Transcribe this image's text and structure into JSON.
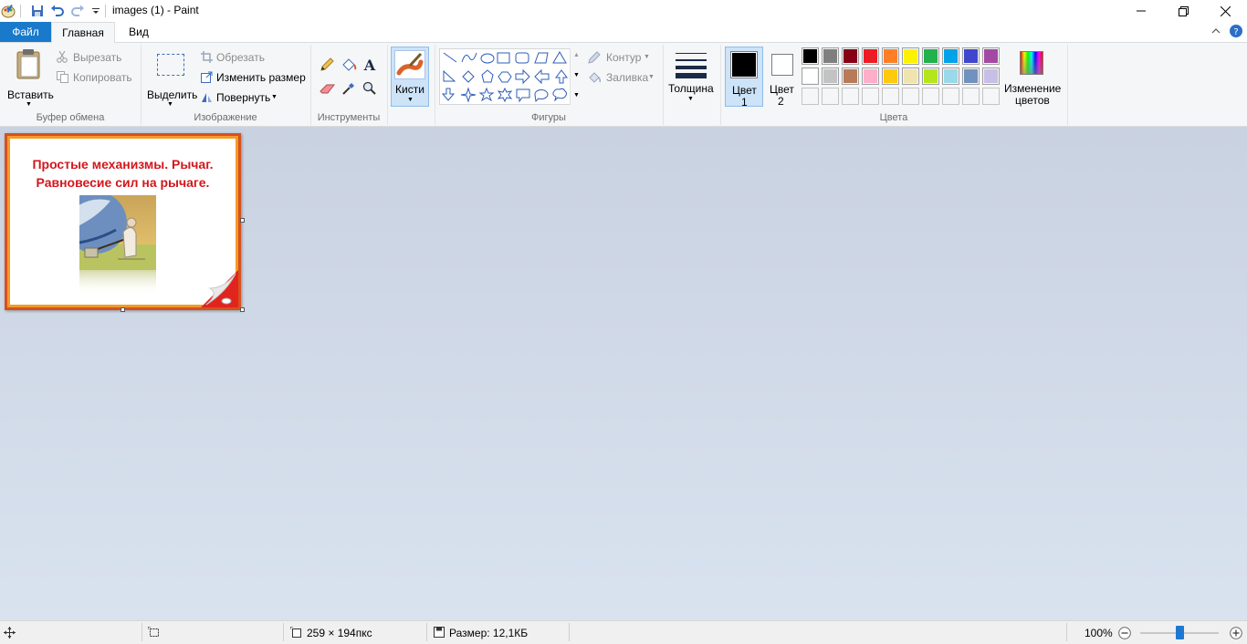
{
  "window": {
    "title": "images (1) - Paint"
  },
  "tabs": {
    "file": "Файл",
    "home": "Главная",
    "view": "Вид"
  },
  "clipboard": {
    "paste": "Вставить",
    "cut": "Вырезать",
    "copy": "Копировать",
    "label": "Буфер обмена"
  },
  "image": {
    "select": "Выделить",
    "crop": "Обрезать",
    "resize": "Изменить размер",
    "rotate": "Повернуть",
    "label": "Изображение"
  },
  "tools": {
    "label": "Инструменты"
  },
  "brushes": {
    "label": "Кисти"
  },
  "shapes": {
    "outline": "Контур",
    "fill": "Заливка",
    "label": "Фигуры"
  },
  "size": {
    "label": "Толщина"
  },
  "colors": {
    "color1_line1": "Цвет",
    "color1_line2": "1",
    "color2_line1": "Цвет",
    "color2_line2": "2",
    "edit_line1": "Изменение",
    "edit_line2": "цветов",
    "label": "Цвета",
    "color1_value": "#000000",
    "color2_value": "#ffffff",
    "palette_row1": [
      "#000000",
      "#7f7f7f",
      "#880015",
      "#ed1c24",
      "#ff7f27",
      "#fff200",
      "#22b14c",
      "#00a2e8",
      "#3f48cc",
      "#a349a4"
    ],
    "palette_row2": [
      "#ffffff",
      "#c3c3c3",
      "#b97a57",
      "#ffaec9",
      "#ffc90e",
      "#efe4b0",
      "#b5e61d",
      "#99d9ea",
      "#7092be",
      "#c8bfe7"
    ]
  },
  "canvas_image": {
    "title_line1": "Простые механизмы. Рычаг.",
    "title_line2": "Равновесие сил на рычаге."
  },
  "status": {
    "dimensions": "259 × 194пкс",
    "file_size": "Размер: 12,1КБ",
    "zoom": "100%"
  }
}
